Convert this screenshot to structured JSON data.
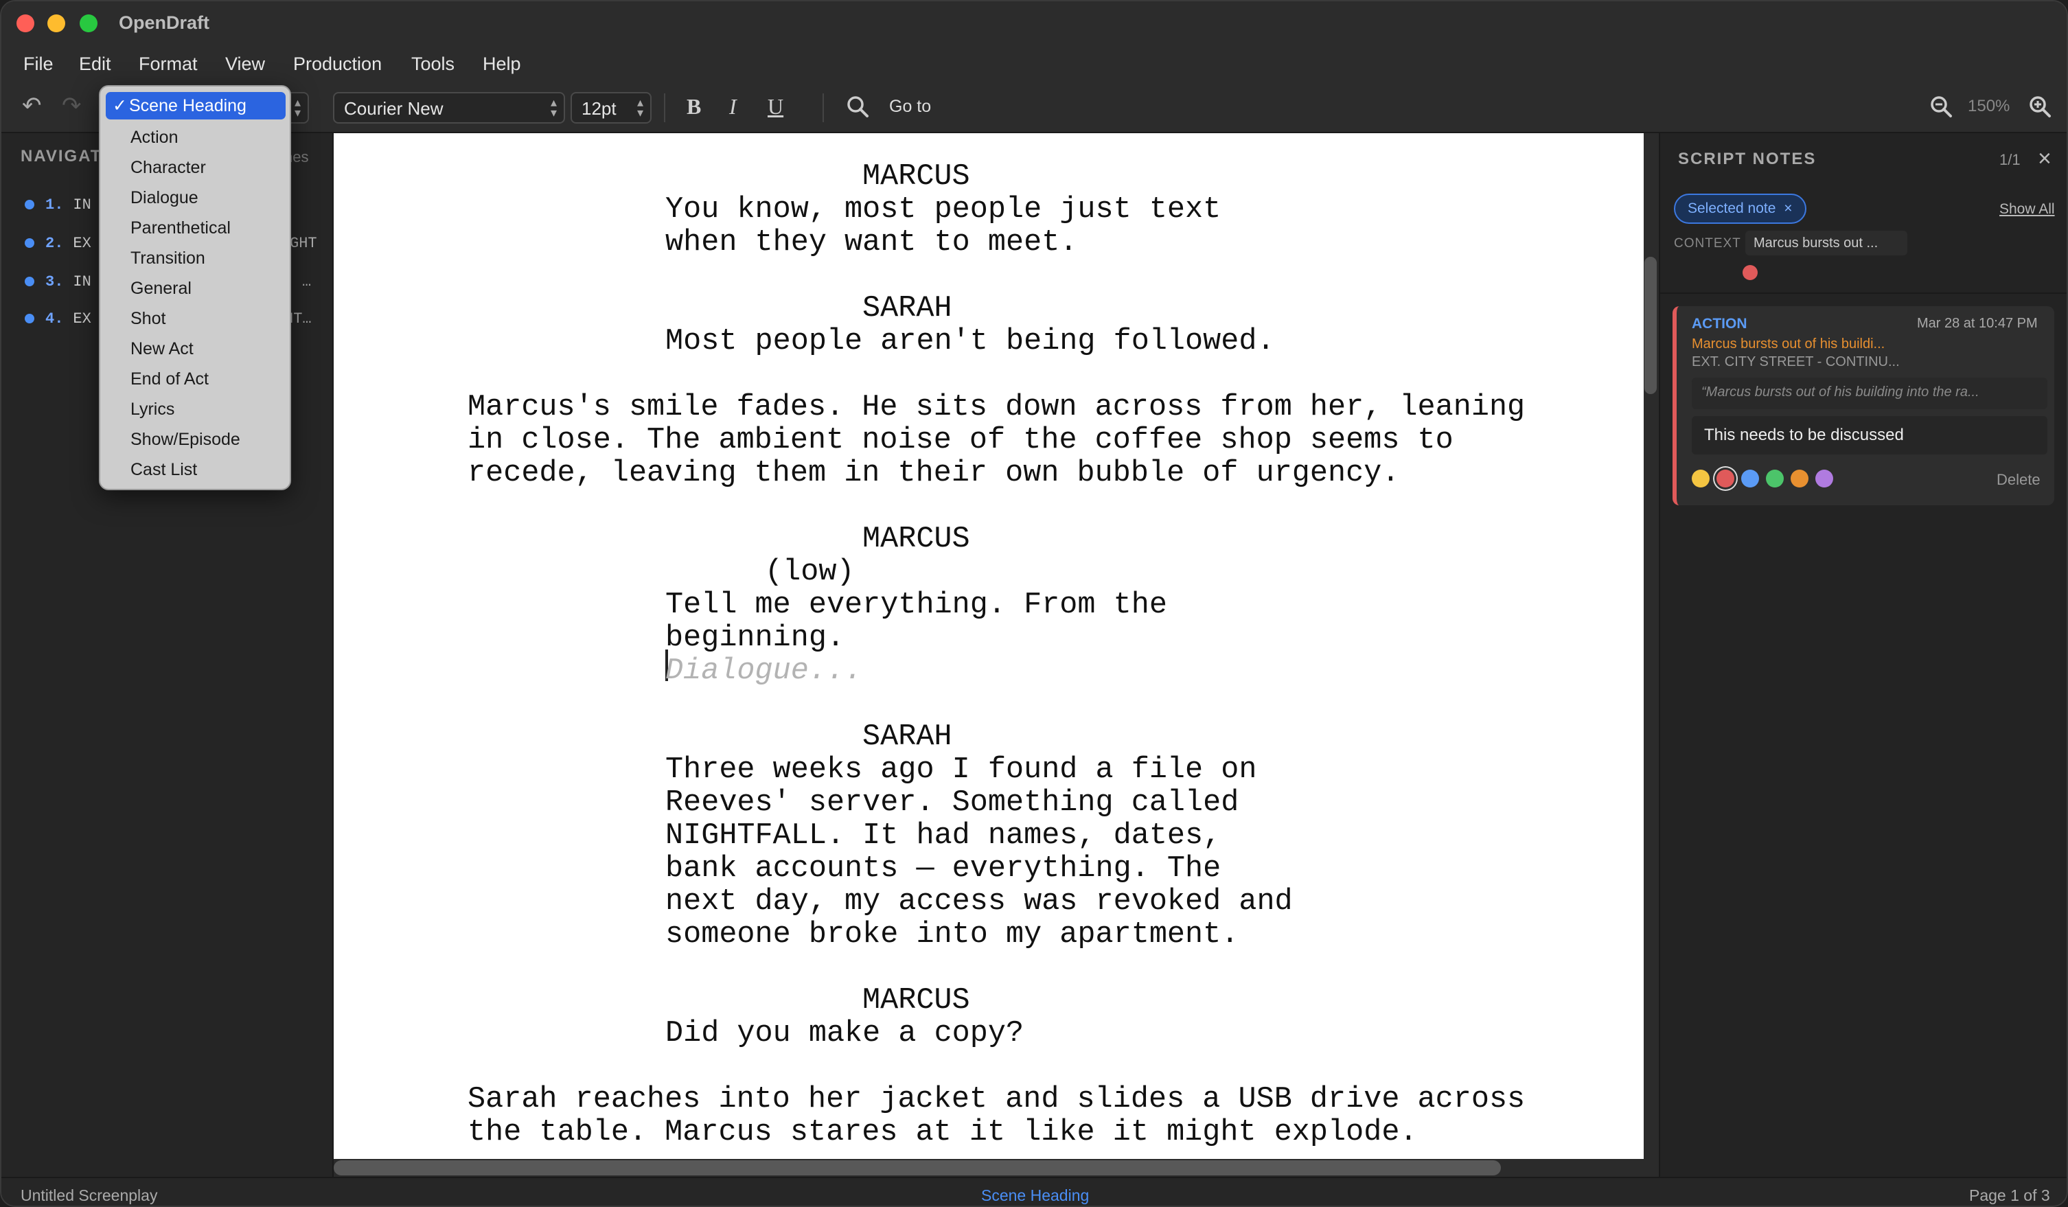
{
  "app": {
    "title": "OpenDraft"
  },
  "menu": [
    "File",
    "Edit",
    "Format",
    "View",
    "Production",
    "Tools",
    "Help"
  ],
  "toolbar": {
    "element_type": "Scene Heading",
    "font": "Courier New",
    "size": "12pt",
    "bold": "B",
    "italic": "I",
    "underline": "U",
    "goto": "Go to",
    "zoom": "150%",
    "icons": [
      "undo-icon",
      "redo-icon",
      "search-icon",
      "zoom-out-icon",
      "zoom-in-icon"
    ]
  },
  "navigator": {
    "title": "NAVIGAT",
    "right_label": "nes",
    "items": [
      {
        "num": "1.",
        "text": "IN"
      },
      {
        "num": "2.",
        "text": "EX"
      },
      {
        "num": "3.",
        "text": "IN"
      },
      {
        "num": "4.",
        "text": "EX"
      }
    ],
    "item_tail": [
      "",
      "GHT",
      "…",
      "NT…"
    ]
  },
  "dropdown": {
    "selected": "Scene Heading",
    "check": "✓",
    "items": [
      "Action",
      "Character",
      "Dialogue",
      "Parenthetical",
      "Transition",
      "General",
      "Shot",
      "New Act",
      "End of Act",
      "Lyrics",
      "Show/Episode",
      "Cast List"
    ]
  },
  "script": {
    "lines": [
      "MARCUS",
      "You know, most people just text",
      "when they want to meet.",
      "SARAH",
      "Most people aren't being followed.",
      "Marcus's smile fades. He sits down across from her, leaning",
      "in close. The ambient noise of the coffee shop seems to",
      "recede, leaving them in their own bubble of urgency.",
      "MARCUS",
      "(low)",
      "Tell me everything. From the",
      "beginning.",
      "SARAH",
      "Three weeks ago I found a file on",
      "Reeves' server. Something called",
      "NIGHTFALL. It had names, dates,",
      "bank accounts — everything. The",
      "next day, my access was revoked and",
      "someone broke into my apartment.",
      "MARCUS",
      "Did you make a copy?",
      "Sarah reaches into her jacket and slides a USB drive across",
      "the table. Marcus stares at it like it might explode."
    ],
    "placeholder": "Dialogue..."
  },
  "notes": {
    "title": "SCRIPT NOTES",
    "count": "1/1",
    "filter_chip": "Selected note",
    "show_all": "Show All",
    "context_label": "CONTEXT",
    "context_value": "Marcus bursts out ...",
    "card": {
      "type": "ACTION",
      "date": "Mar 28 at 10:47 PM",
      "scene_line": "Marcus bursts out of his buildi...",
      "location": "EXT. CITY STREET - CONTINU...",
      "quote": "“Marcus bursts out of his building into the ra...",
      "text": "This needs to be discussed",
      "delete": "Delete",
      "colors": [
        "#f4c542",
        "#e05a5a",
        "#5b9bf5",
        "#4cc46a",
        "#e89030",
        "#b07be0"
      ]
    }
  },
  "status": {
    "left": "Untitled Screenplay",
    "center": "Scene Heading",
    "right": "Page 1 of 3"
  }
}
